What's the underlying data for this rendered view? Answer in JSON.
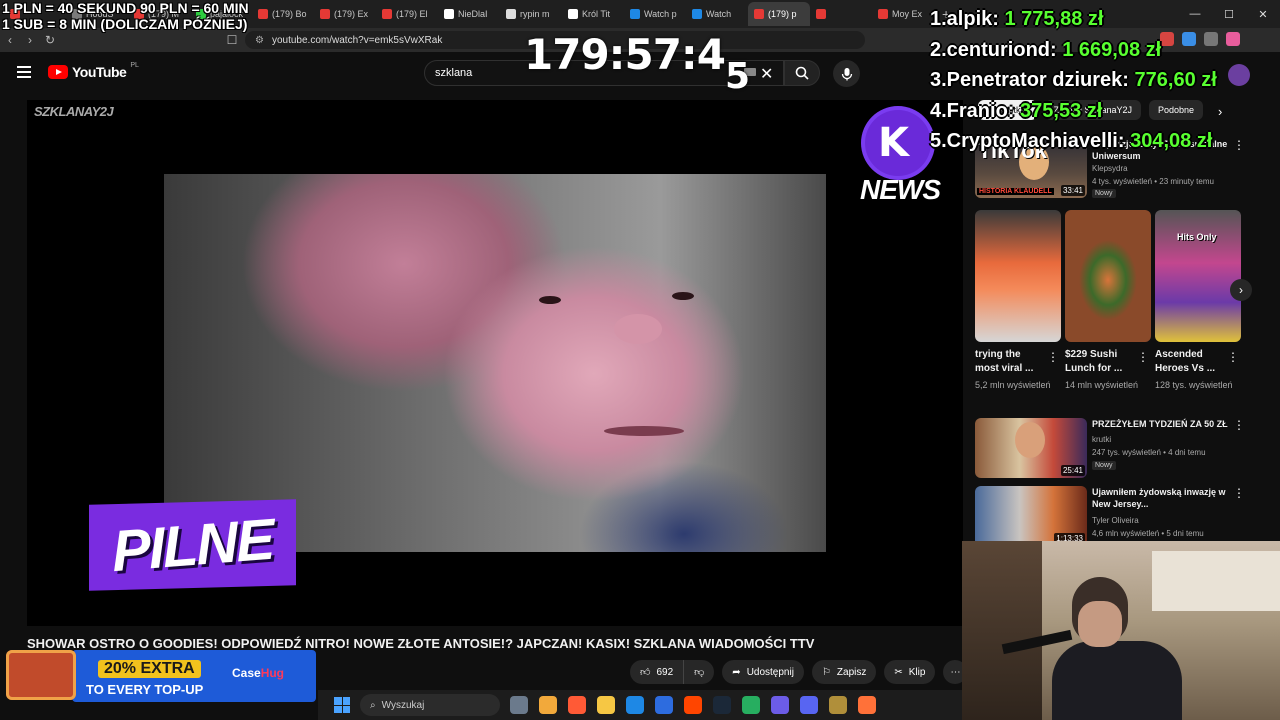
{
  "browser": {
    "tabs": [
      {
        "label": "",
        "color": "#e53935"
      },
      {
        "label": "HoodS",
        "color": "#7b7b7b"
      },
      {
        "label": "(179) M",
        "color": "#e53935"
      },
      {
        "label": "pajalock",
        "color": "#2ecc40"
      },
      {
        "label": "(179) Bo",
        "color": "#e53935"
      },
      {
        "label": "(179) Ex",
        "color": "#e53935"
      },
      {
        "label": "(179) El",
        "color": "#e53935"
      },
      {
        "label": "NieDlaI",
        "color": "#ffffff"
      },
      {
        "label": "rypin m",
        "color": "#dddddd"
      },
      {
        "label": "Król Tit",
        "color": "#ffffff"
      },
      {
        "label": "Watch p",
        "color": "#1e88e5"
      },
      {
        "label": "Watch",
        "color": "#1e88e5"
      },
      {
        "label": "(179) p",
        "color": "#e53935"
      },
      {
        "label": "",
        "color": "#e53935"
      },
      {
        "label": "Moy Ex",
        "color": "#e53935"
      }
    ],
    "url": "youtube.com/watch?v=emk5sVwXRak",
    "new_tab": "+"
  },
  "youtube": {
    "logo_text": "YouTube",
    "country_code": "PL",
    "search_query": "szklana",
    "clear": "✕"
  },
  "player": {
    "watermark": "SZKLANAY2J",
    "pilne": "PILNE",
    "news_logo": "NEWS",
    "news_k": "K"
  },
  "video": {
    "title": "SHOWAR OSTRO O GOODIES! ODPOWIEDŹ NITRO! NOWE ZŁOTE ANTOSIE!? JAPCZAN! KASIX! SZKLANA WIADOMOŚCI TTV",
    "likes": "692",
    "share": "Udostępnij",
    "save": "Zapisz",
    "clip": "Klip"
  },
  "ad": {
    "line1": "20% EXTRA",
    "line2": "TO EVERY TOP-UP",
    "brand_a": "Case",
    "brand_b": "Hug"
  },
  "sidebar": {
    "chips": [
      "Wszystkie",
      "Z cyklu SzklanaY2J",
      "Podobne"
    ],
    "rec1": {
      "title": "Antywizjonerzy: Jej Absurdalne Uniwersum",
      "channel": "Klepsydra",
      "meta": "4 tys. wyświetleń • 23 minuty temu",
      "badge": "Nowy",
      "duration": "33:41",
      "thumb_label": "HISTORIA KLAUDELL"
    },
    "shorts": [
      {
        "title": "trying the most viral ...",
        "views": "5,2 mln wyświetleń"
      },
      {
        "title": "$229 Sushi Lunch for ...",
        "views": "14 mln wyświetleń"
      },
      {
        "title": "Ascended Heroes Vs ...",
        "views": "128 tys. wyświetleń",
        "thumb_label": "Hits Only"
      }
    ],
    "rec2": {
      "title": "PRZEŻYŁEM TYDZIEŃ ZA 50 ZŁ",
      "channel": "krutki",
      "meta": "247 tys. wyświetleń • 4 dni temu",
      "badge": "Nowy",
      "duration": "25:41"
    },
    "rec3": {
      "title": "Ujawniłem żydowską inwazję w New Jersey...",
      "channel": "Tyler Oliveira",
      "meta": "4,6 mln wyświetleń • 5 dni temu",
      "duration": "1:13:33"
    }
  },
  "overlay": {
    "line1": "1 PLN = 40 SEKUND 90 PLN = 60 MIN",
    "line2": "1 SUB = 8 MIN (DOLICZAM PÓŹNIEJ)",
    "timer": "179:57:4",
    "timer_sub": "5",
    "tiktok": "TikTok",
    "leaderboard": [
      {
        "name": "1.alpik:",
        "amount": "1 775,88 zł"
      },
      {
        "name": "2.centuriond:",
        "amount": "1 669,08 zł"
      },
      {
        "name": "3.Penetrator dziurek:",
        "amount": "776,60 zł"
      },
      {
        "name": "4.Franio:",
        "amount": "375,53 zł"
      },
      {
        "name": "5.CryptoMachiavelli:",
        "amount": "304,08 zł"
      }
    ]
  },
  "taskbar": {
    "search_placeholder": "Wyszukaj",
    "apps": [
      "#6b7a8c",
      "#f2a93b",
      "#ff5a36",
      "#f6c744",
      "#1e88e5",
      "#2d6cdf",
      "#ff4500",
      "#1b2838",
      "#27ae60",
      "#6c5ce7",
      "#5865f2",
      "#b08f3a",
      "#ff7139"
    ]
  }
}
